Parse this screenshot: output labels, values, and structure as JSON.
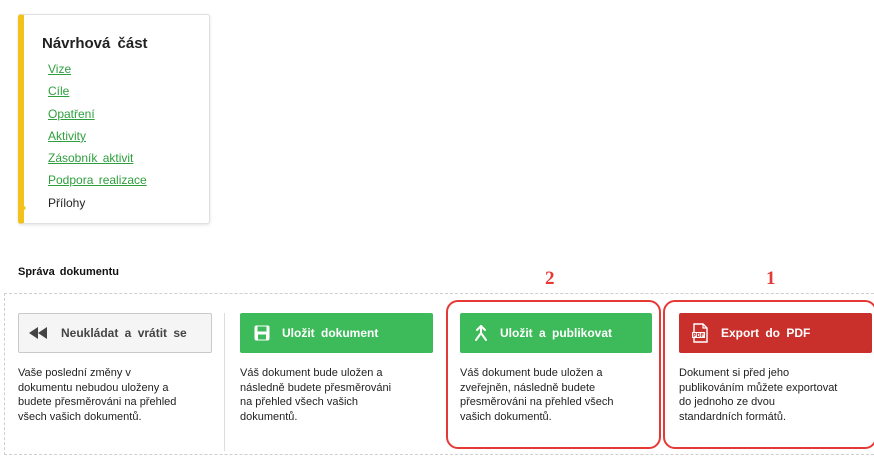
{
  "nav": {
    "title": "Návrhová část",
    "items": [
      {
        "label": "Vize"
      },
      {
        "label": "Cíle"
      },
      {
        "label": "Opatření"
      },
      {
        "label": "Aktivity"
      },
      {
        "label": "Zásobník aktivit"
      },
      {
        "label": "Podpora realizace"
      },
      {
        "label": "Přílohy"
      }
    ],
    "accent_color": "#f2c21b"
  },
  "section": {
    "title": "Správa dokumentu"
  },
  "actions": [
    {
      "label": "Neukládat a vrátit se",
      "icon": "double-chevron-left-icon",
      "description_lines": [
        "Vaše poslední změny v",
        "dokumentu nebudou uloženy a",
        "budete přesměrováni na přehled",
        "všech vašich dokumentů."
      ]
    },
    {
      "label": "Uložit dokument",
      "icon": "floppy-disk-icon",
      "description_lines": [
        "Váš dokument bude uložen a",
        "následně budete přesměrováni",
        "na přehled všech vašich",
        "dokumentů."
      ]
    },
    {
      "label": "Uložit a publikovat",
      "icon": "merge-arrow-icon",
      "description_lines": [
        "Váš dokument bude uložen a",
        "zveřejněn, následně budete",
        "přesměrováni na přehled všech",
        "vašich dokumentů."
      ]
    },
    {
      "label": "Export do PDF",
      "icon": "pdf-file-icon",
      "description_lines": [
        "Dokument si před jeho",
        "publikováním můžete exportovat",
        "do jednoho ze dvou",
        "standardních formátů."
      ]
    }
  ],
  "annotations": {
    "publish_marker": "2",
    "export_marker": "1",
    "color": "#e53935"
  },
  "colors": {
    "green": "#3dba5a",
    "red": "#c9302c",
    "link": "#2e9e3e"
  }
}
